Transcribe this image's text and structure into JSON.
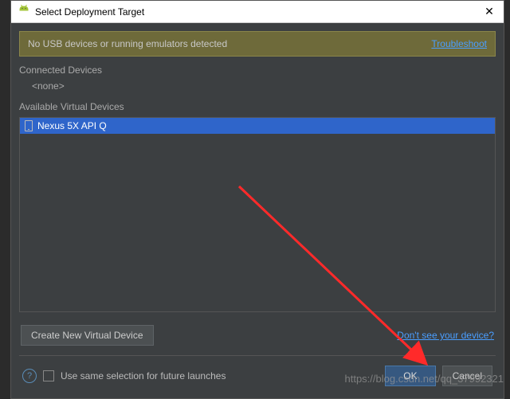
{
  "titlebar": {
    "title": "Select Deployment Target"
  },
  "warn": {
    "msg": "No USB devices or running emulators detected",
    "link": "Troubleshoot"
  },
  "sections": {
    "connected": "Connected Devices",
    "none": "<none>",
    "available": "Available Virtual Devices"
  },
  "devices": [
    {
      "name": "Nexus 5X API Q",
      "selected": true
    }
  ],
  "bottom": {
    "create": "Create New Virtual Device",
    "dontsee": "Don't see your device?"
  },
  "footer": {
    "checkbox_label": "Use same selection for future launches",
    "ok": "OK",
    "cancel": "Cancel"
  },
  "watermark": "https://blog.csdn.net/qq_37992321"
}
